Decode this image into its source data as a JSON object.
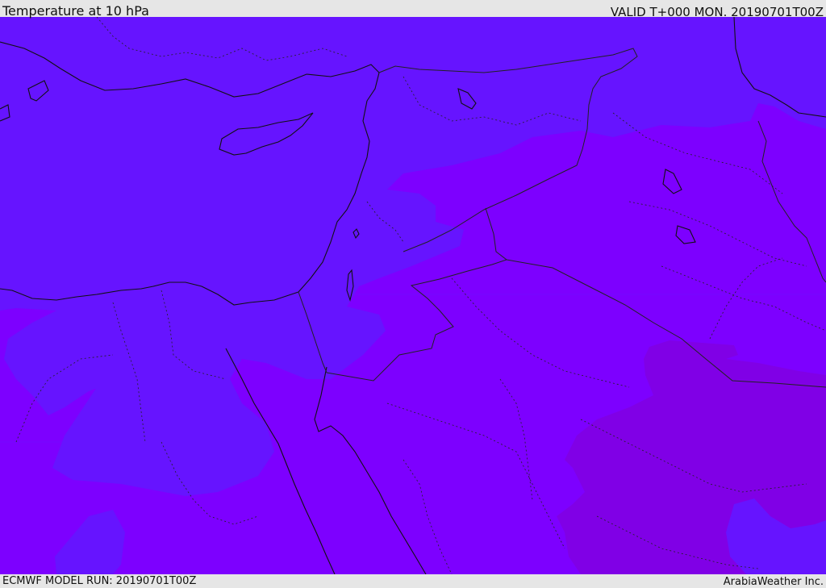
{
  "header": {
    "title": "Temperature at 10 hPa",
    "valid": "VALID T+000 MON. 20190701T00Z"
  },
  "footer": {
    "model_run": "ECMWF MODEL RUN: 20190701T00Z",
    "credit": "ArabiaWeather Inc."
  },
  "colors": {
    "band_cold": "#6614ff",
    "band_mid": "#7d00ff",
    "band_warm": "#8000e6",
    "coast_line": "#111111",
    "border_line": "#222222",
    "bar_bg": "#e6e6e6"
  }
}
